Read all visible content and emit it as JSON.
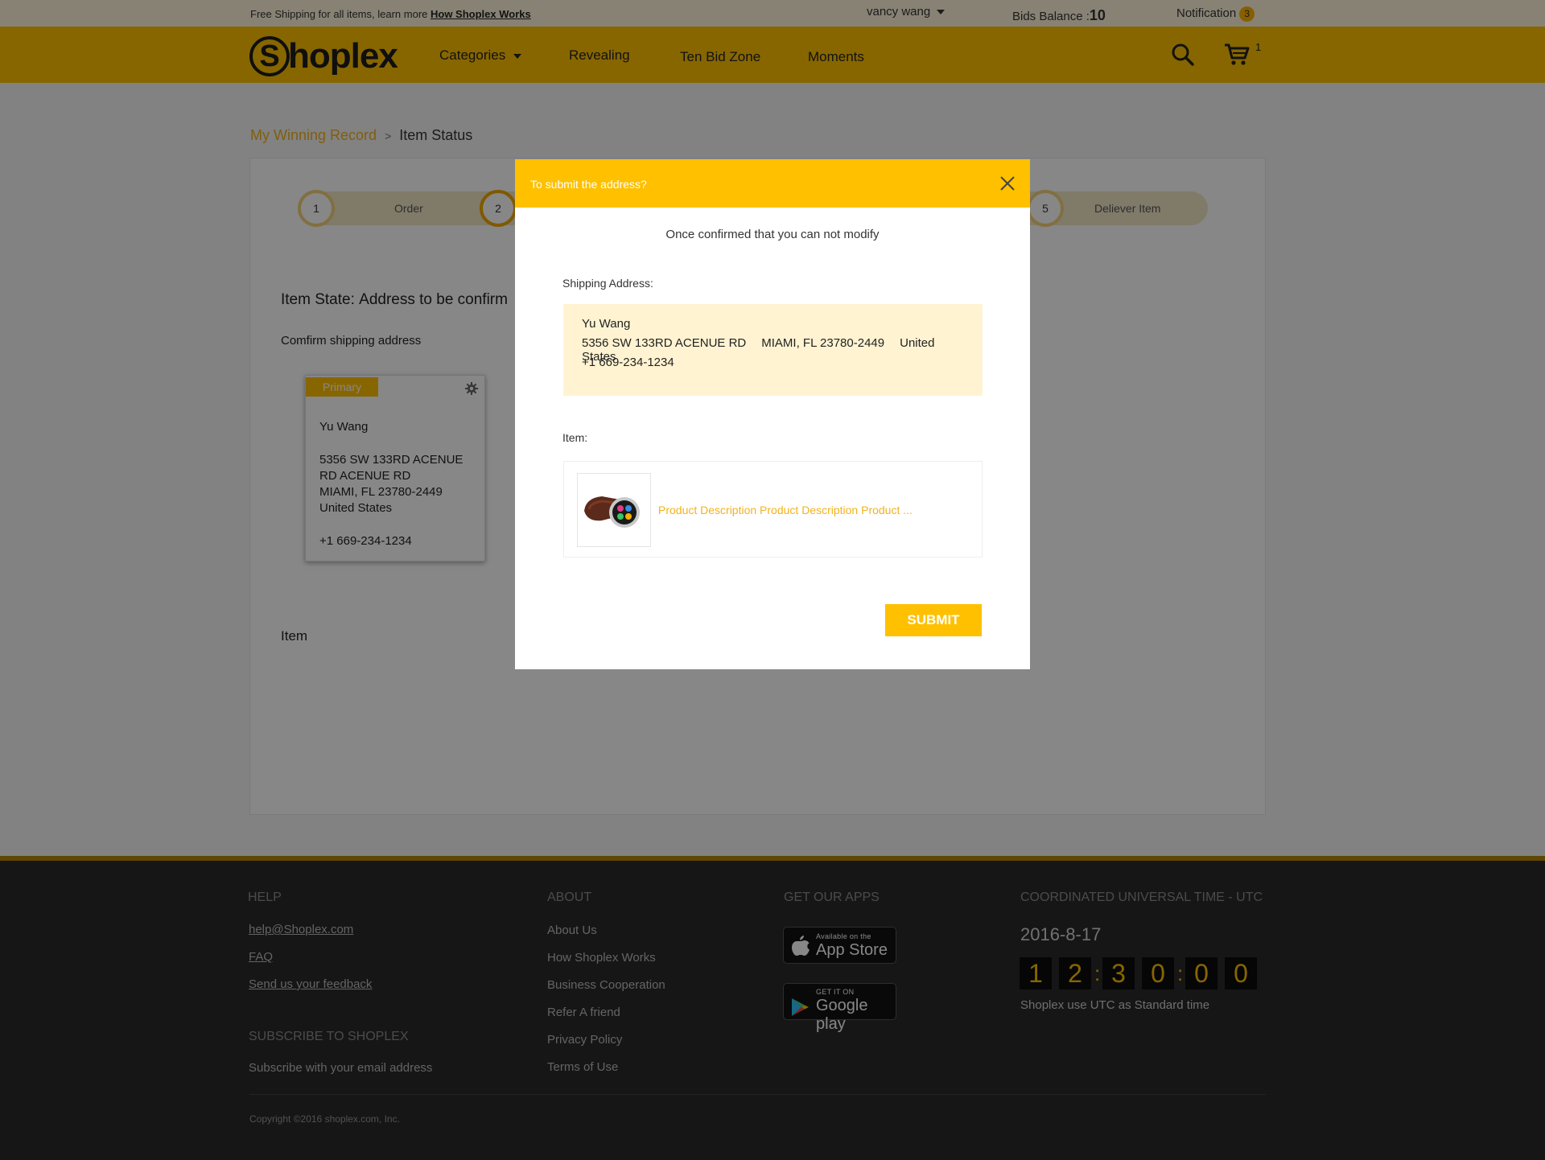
{
  "topbar": {
    "notice": "Free Shipping for all items, learn more",
    "notice_link": "How Shoplex Works",
    "user_name": "vancy wang",
    "bids_label": "Bids Balance :",
    "bids_value": "10",
    "notification_label": "Notification",
    "notification_count": "3"
  },
  "nav": {
    "logo_letter": "S",
    "logo_text": "hoplex",
    "items": [
      {
        "label": "Categories"
      },
      {
        "label": "Revealing"
      },
      {
        "label": "Ten Bid Zone"
      },
      {
        "label": "Moments"
      }
    ],
    "cart_count": "1"
  },
  "breadcrumb": {
    "link": "My Winning Record",
    "separator": ">",
    "current": "Item Status"
  },
  "steps": [
    {
      "number": "1",
      "label": "Order"
    },
    {
      "number": "2",
      "label": ""
    },
    {
      "number": "5",
      "label": "Deliever Item"
    }
  ],
  "item_state": {
    "label": "Item State:",
    "value": "Address to be confirm"
  },
  "confirm_shipping_label": "Comfirm shipping address",
  "address_card": {
    "badge": "Primary",
    "name": "Yu Wang",
    "street1": "5356 SW 133RD ACENUE",
    "street2": "RD ACENUE RD",
    "city": "MIAMI, FL 23780-2449",
    "country": "United States",
    "phone": "+1 669-234-1234"
  },
  "item_section_label": "Item",
  "modal": {
    "title": "To submit the address?",
    "subtitle": "Once confirmed that you can not modify",
    "shipping_label": "Shipping Address:",
    "name": "Yu Wang",
    "street": "5356 SW 133RD ACENUE RD",
    "city": "MIAMI, FL 23780-2449",
    "country": "United States",
    "phone": "+1 669-234-1234",
    "item_label": "Item:",
    "product_desc": "Product Description Product Description Product ...",
    "submit_label": "SUBMIT"
  },
  "footer": {
    "help": {
      "title": "HELP",
      "email": "help@Shoplex.com",
      "faq": "FAQ",
      "feedback": "Send us your feedback"
    },
    "subscribe": {
      "title": "SUBSCRIBE TO SHOPLEX",
      "text": "Subscribe with your email address"
    },
    "about": {
      "title": "ABOUT",
      "links": [
        "About Us",
        "How Shoplex Works",
        "Business Cooperation",
        "Refer A friend",
        "Privacy Policy",
        "Terms of Use"
      ]
    },
    "apps": {
      "title": "GET OUR APPS",
      "appstore_small": "Available on the",
      "appstore_big": "App Store",
      "googleplay_small": "GET IT ON",
      "googleplay_big": "Google play"
    },
    "utc": {
      "title": "COORDINATED UNIVERSAL TIME - UTC",
      "date": "2016-8-17",
      "digits": [
        "1",
        "2",
        "3",
        "0",
        "0",
        "0"
      ],
      "note": "Shoplex use UTC as Standard time"
    },
    "copyright": "Copyright ©2016 shoplex.com, Inc."
  },
  "colors": {
    "brand_yellow": "#ffc000",
    "link_orange": "#f3b21c",
    "address_bg": "#fff3d1",
    "footer_bg": "#2a2a2a"
  },
  "icons": [
    "search-icon",
    "cart-icon",
    "gear-icon",
    "close-icon",
    "apple-icon",
    "play-icon",
    "watch-product-image",
    "chevron-down-icon"
  ]
}
